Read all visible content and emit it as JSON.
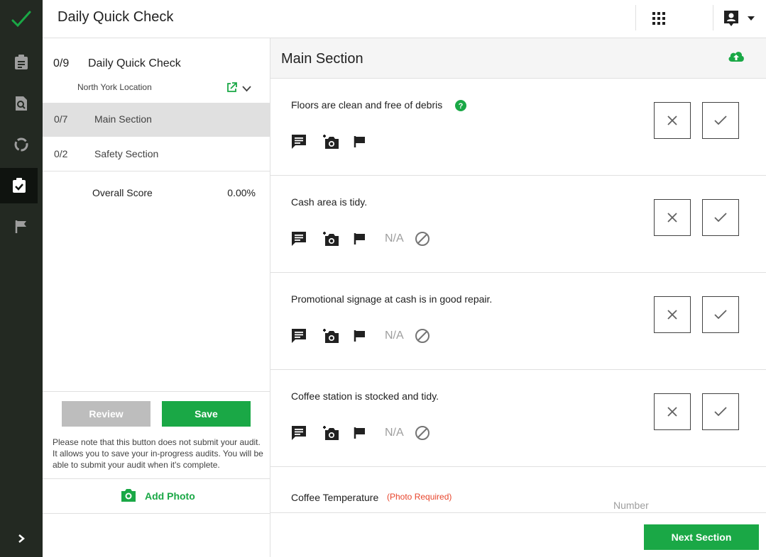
{
  "app": {
    "title": "Daily Quick Check"
  },
  "audit": {
    "progress": "0/9",
    "name": "Daily Quick Check",
    "location": "North York Location"
  },
  "sections": [
    {
      "progress": "0/7",
      "name": "Main Section",
      "active": true
    },
    {
      "progress": "0/2",
      "name": "Safety Section",
      "active": false
    }
  ],
  "score": {
    "label": "Overall Score",
    "value": "0.00%"
  },
  "actions": {
    "review": "Review",
    "save": "Save",
    "note": "Please note that this button does not submit your audit. It allows you to save your in-progress audits. You will be able to submit your audit when it's complete.",
    "add_photo": "Add Photo"
  },
  "main": {
    "section_title": "Main Section",
    "questions": [
      {
        "text": "Floors are clean and free of debris",
        "has_help": true,
        "has_na": false
      },
      {
        "text": "Cash area is tidy.",
        "has_help": false,
        "has_na": true
      },
      {
        "text": "Promotional signage at cash is in good repair.",
        "has_help": false,
        "has_na": true
      },
      {
        "text": "Coffee station is stocked and tidy.",
        "has_help": false,
        "has_na": true
      }
    ],
    "na_label": "N/A",
    "temperature": {
      "text": "Coffee Temperature",
      "required": "(Photo Required)",
      "placeholder": "Number",
      "value": ""
    },
    "next": "Next Section"
  },
  "colors": {
    "accent": "#1aa846",
    "rail": "#232922",
    "required": "#e8452c"
  }
}
